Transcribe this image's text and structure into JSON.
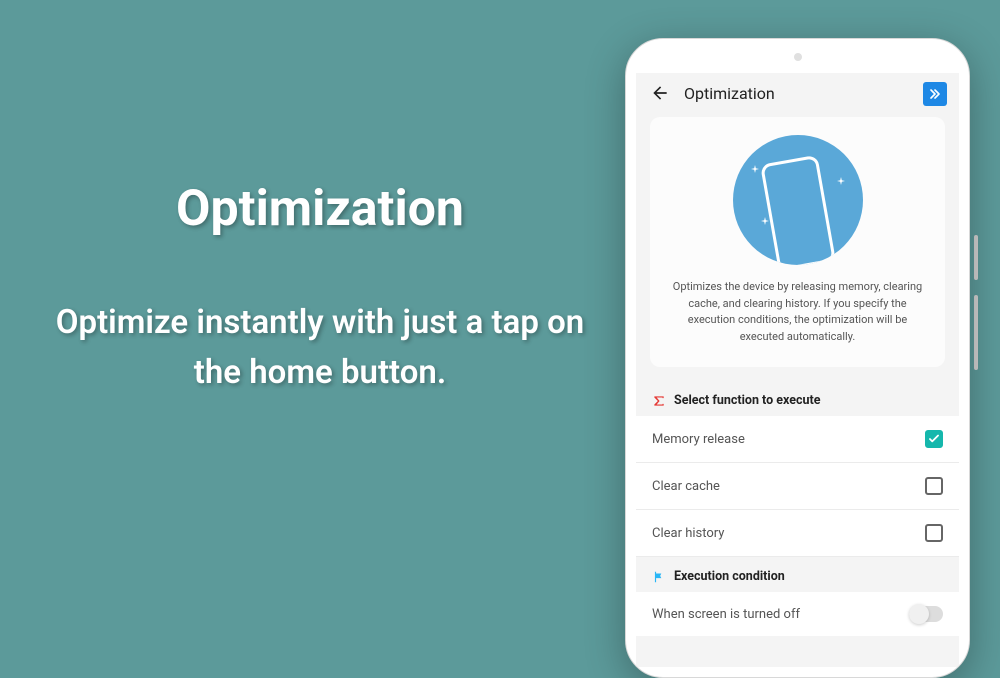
{
  "promo": {
    "title": "Optimization",
    "subtitle": "Optimize instantly with just a tap on the home button."
  },
  "app": {
    "bar_title": "Optimization"
  },
  "hero": {
    "description": "Optimizes the device by releasing memory, clearing cache, and clearing history. If you specify the execution conditions, the optimization will be executed automatically."
  },
  "sections": {
    "functions": {
      "title": "Select function to execute",
      "items": [
        {
          "label": "Memory release",
          "checked": true
        },
        {
          "label": "Clear cache",
          "checked": false
        },
        {
          "label": "Clear history",
          "checked": false
        }
      ]
    },
    "conditions": {
      "title": "Execution condition",
      "items": [
        {
          "label": "When screen is turned off",
          "on": false
        }
      ]
    }
  }
}
